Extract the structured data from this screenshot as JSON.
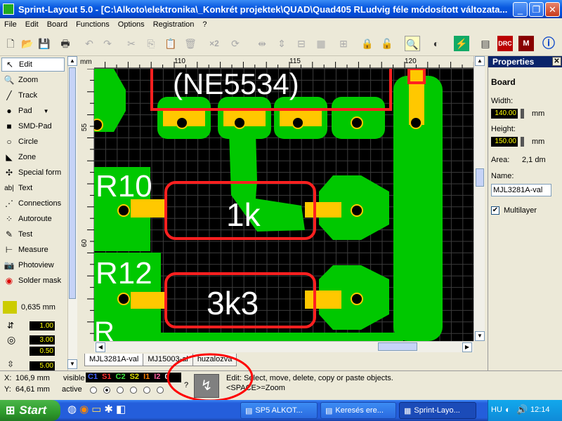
{
  "window": {
    "title": "Sprint-Layout 5.0 - [C:\\Alkoto\\elektronika\\_Konkrét projektek\\QUAD\\Quad405 RLudvig féle módosított változata...",
    "minimize": "_",
    "maximize": "❐",
    "close": "✕"
  },
  "menu": [
    "File",
    "Edit",
    "Board",
    "Functions",
    "Options",
    "Registration",
    "?"
  ],
  "toolbar": {
    "x2_label": "×2"
  },
  "tools": [
    {
      "label": "Edit",
      "icon": "cursor-icon",
      "glyph": "↖"
    },
    {
      "label": "Zoom",
      "icon": "magnifier-icon",
      "glyph": "🔍"
    },
    {
      "label": "Track",
      "icon": "track-icon",
      "glyph": "╱"
    },
    {
      "label": "Pad",
      "icon": "pad-icon",
      "glyph": "●"
    },
    {
      "label": "SMD-Pad",
      "icon": "smd-pad-icon",
      "glyph": "■"
    },
    {
      "label": "Circle",
      "icon": "circle-icon",
      "glyph": "○"
    },
    {
      "label": "Zone",
      "icon": "zone-icon",
      "glyph": "◣"
    },
    {
      "label": "Special form",
      "icon": "special-form-icon",
      "glyph": "✣"
    },
    {
      "label": "Text",
      "icon": "text-icon",
      "glyph": "ab|"
    },
    {
      "label": "Connections",
      "icon": "connections-icon",
      "glyph": "⋰"
    },
    {
      "label": "Autoroute",
      "icon": "autoroute-icon",
      "glyph": "⁘"
    },
    {
      "label": "Test",
      "icon": "test-icon",
      "glyph": "✎"
    },
    {
      "label": "Measure",
      "icon": "measure-icon",
      "glyph": "⊢"
    },
    {
      "label": "Photoview",
      "icon": "photoview-icon",
      "glyph": "📷"
    },
    {
      "label": "Solder mask",
      "icon": "solder-mask-icon",
      "glyph": "◉"
    }
  ],
  "grid": {
    "value": "0,635 mm"
  },
  "track_values": [
    "1.00",
    "3.00",
    "0.50",
    "5.00"
  ],
  "ruler": {
    "unit": "mm",
    "top_labels": [
      "110",
      "115",
      "120"
    ],
    "left_labels": [
      "55",
      "60"
    ]
  },
  "pcb_labels": {
    "ic": "(NE5534)",
    "r10": "R10",
    "r10_value": "1k",
    "r12": "R12",
    "r12_value": "3k3",
    "partial": "R"
  },
  "tabs": [
    "MJL3281A-val",
    "MJ15003-al",
    "huzalozva"
  ],
  "properties": {
    "header": "Properties",
    "section": "Board",
    "width_label": "Width:",
    "width_value": "140.00",
    "height_label": "Height:",
    "height_value": "150.00",
    "unit": "mm",
    "area_label": "Area:",
    "area_value": "2,1 dm",
    "name_label": "Name:",
    "name_value": "MJL3281A-val",
    "multilayer_label": "Multilayer",
    "multilayer_checked": "✔"
  },
  "status": {
    "x_label": "X:",
    "x_value": "106,9 mm",
    "y_label": "Y:",
    "y_value": "64,61 mm",
    "visible_label": "visible",
    "active_label": "active",
    "layers": [
      "C1",
      "S1",
      "C2",
      "S2",
      "I1",
      "I2",
      "0"
    ],
    "question": "?",
    "hint_line1": "Edit: Select, move, delete, copy or paste objects.",
    "hint_line2": "<SPACE>=Zoom"
  },
  "taskbar": {
    "start": "Start",
    "tasks": [
      "SP5 ALKOT...",
      "Keresés ere...",
      "Sprint-Layo..."
    ],
    "tray_text": "HU",
    "clock": "12:14"
  },
  "colors": {
    "copper_green": "#00c800",
    "copper_yellow": "#ffc800",
    "silk_white": "#ffffff",
    "outline_red": "#ff2020",
    "grid": "#404040",
    "annotation_red": "#ff0000"
  }
}
